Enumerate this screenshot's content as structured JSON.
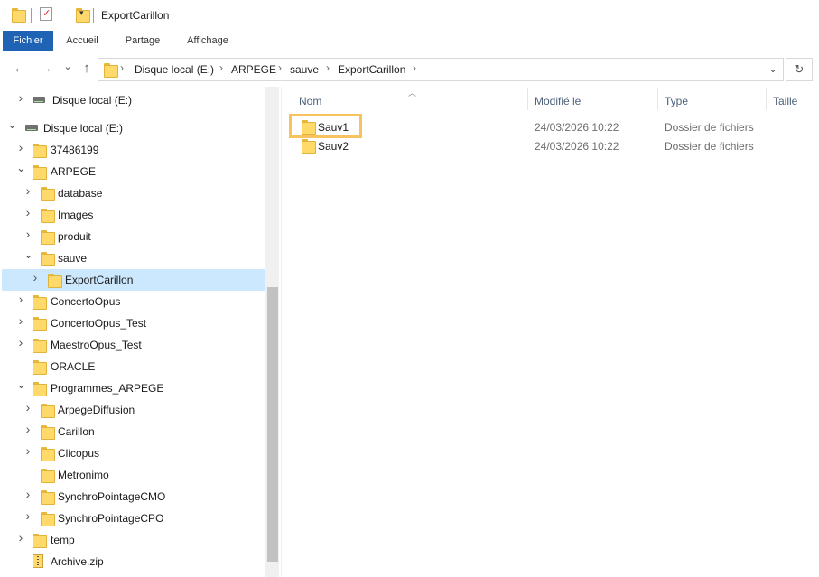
{
  "window": {
    "title": "ExportCarillon"
  },
  "ribbon": {
    "tabs": [
      "Fichier",
      "Accueil",
      "Partage",
      "Affichage"
    ]
  },
  "address": {
    "crumbs": [
      "Disque local (E:)",
      "ARPEGE",
      "sauve",
      "ExportCarillon"
    ],
    "icons": {
      "back": "←",
      "forward": "→",
      "recent": "⌄",
      "up": "↑",
      "dropdown": "⌄",
      "refresh": "↻"
    }
  },
  "nav": {
    "items": [
      {
        "label": "Disque local (E:)",
        "icon": "drive-icon",
        "expand": ">"
      },
      {
        "label": "Disque local (E:)",
        "icon": "drive-icon",
        "expand": "v"
      },
      {
        "label": "37486199",
        "icon": "folder-icon",
        "expand": ">"
      },
      {
        "label": "ARPEGE",
        "icon": "folder-icon",
        "expand": "v"
      },
      {
        "label": "database",
        "icon": "folder-icon",
        "expand": ">"
      },
      {
        "label": "Images",
        "icon": "folder-icon",
        "expand": ">"
      },
      {
        "label": "produit",
        "icon": "folder-icon",
        "expand": ">"
      },
      {
        "label": "sauve",
        "icon": "folder-icon",
        "expand": "v"
      },
      {
        "label": "ExportCarillon",
        "icon": "folder-icon",
        "expand": ">",
        "selected": true
      },
      {
        "label": "ConcertoOpus",
        "icon": "folder-icon",
        "expand": ">"
      },
      {
        "label": "ConcertoOpus_Test",
        "icon": "folder-icon",
        "expand": ">"
      },
      {
        "label": "MaestroOpus_Test",
        "icon": "folder-icon",
        "expand": ">"
      },
      {
        "label": "ORACLE",
        "icon": "folder-icon",
        "expand": ""
      },
      {
        "label": "Programmes_ARPEGE",
        "icon": "folder-icon",
        "expand": "v"
      },
      {
        "label": "ArpegeDiffusion",
        "icon": "folder-icon",
        "expand": ">"
      },
      {
        "label": "Carillon",
        "icon": "folder-icon",
        "expand": ">"
      },
      {
        "label": "Clicopus",
        "icon": "folder-icon",
        "expand": ">"
      },
      {
        "label": "Metronimo",
        "icon": "folder-icon",
        "expand": ""
      },
      {
        "label": "SynchroPointageCMO",
        "icon": "folder-icon",
        "expand": ">"
      },
      {
        "label": "SynchroPointageCPO",
        "icon": "folder-icon",
        "expand": ">"
      },
      {
        "label": "temp",
        "icon": "folder-icon",
        "expand": ">"
      },
      {
        "label": "Archive.zip",
        "icon": "zip-icon",
        "expand": ""
      }
    ]
  },
  "columns": {
    "name": "Nom",
    "modified": "Modifié le",
    "type": "Type",
    "size": "Taille"
  },
  "files": [
    {
      "name": "Sauv1",
      "modified": "24/03/2026 10:22",
      "type": "Dossier de fichiers",
      "highlighted": true
    },
    {
      "name": "Sauv2",
      "modified": "24/03/2026 10:22",
      "type": "Dossier de fichiers"
    }
  ],
  "colors": {
    "accent": "#1f63b5",
    "selected": "#cce8ff",
    "highlight": "#f7c35e",
    "folder": "#ffd96a"
  }
}
